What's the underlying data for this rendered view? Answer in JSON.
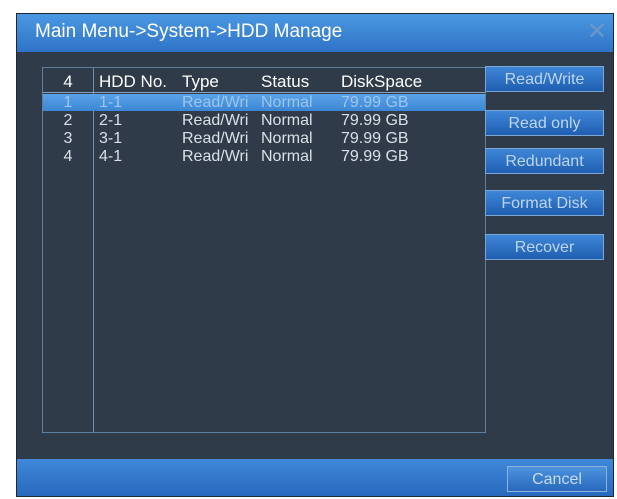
{
  "window": {
    "title": "Main Menu->System->HDD Manage",
    "close_icon": "close-icon"
  },
  "table": {
    "headers": [
      "4",
      "HDD No.",
      "Type",
      "Status",
      "DiskSpace"
    ],
    "rows": [
      [
        "1",
        "1-1",
        "Read/Wri",
        "Normal",
        "79.99 GB"
      ],
      [
        "2",
        "2-1",
        "Read/Wri",
        "Normal",
        "79.99 GB"
      ],
      [
        "3",
        "3-1",
        "Read/Wri",
        "Normal",
        "79.99 GB"
      ],
      [
        "4",
        "4-1",
        "Read/Wri",
        "Normal",
        "79.99 GB"
      ]
    ],
    "selected_row": 0
  },
  "buttons": {
    "read_write": "Read/Write",
    "read_only": "Read only",
    "redundant": "Redundant",
    "format_disk": "Format Disk",
    "recover": "Recover"
  },
  "footer": {
    "cancel": "Cancel"
  },
  "colors": {
    "title_bar": "#3a82d3",
    "panel": "#2f3b48",
    "selected_row": "#4a94df"
  }
}
